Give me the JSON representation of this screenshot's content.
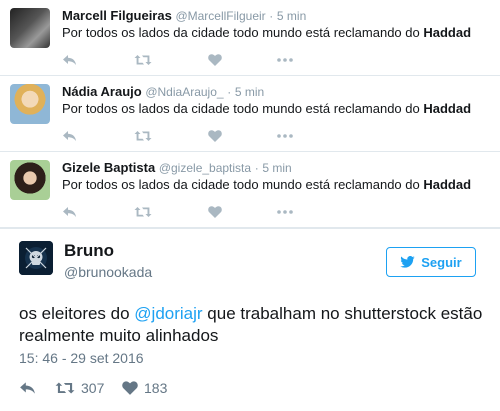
{
  "tweets": [
    {
      "name": "Marcell Filgueiras",
      "handle": "@MarcellFilgueir",
      "time": "5 min",
      "text_before": "Por todos os lados da cidade todo mundo está reclamando do ",
      "text_bold": "Haddad",
      "avatar_colors": [
        "#222222",
        "#777777"
      ]
    },
    {
      "name": "Nádia Araujo",
      "handle": "@NdiaAraujo_",
      "time": "5 min",
      "text_before": "Por todos os lados da cidade todo mundo está reclamando do ",
      "text_bold": "Haddad",
      "avatar_colors": [
        "#e8c07a",
        "#7aa5c8"
      ]
    },
    {
      "name": "Gizele Baptista",
      "handle": "@gizele_baptista",
      "time": "5 min",
      "text_before": "Por todos os lados da cidade todo mundo está reclamando do ",
      "text_bold": "Haddad",
      "avatar_colors": [
        "#3a2a22",
        "#9fc38d"
      ]
    }
  ],
  "separator": "·",
  "expanded": {
    "name": "Bruno",
    "handle": "@brunookada",
    "follow_label": "Seguir",
    "text_before": "os eleitores do ",
    "mention": "@jdoriajr",
    "text_after": " que trabalham no shutterstock estão realmente muito alinhados",
    "timestamp": "15: 46 - 29 set 2016",
    "retweets": "307",
    "likes": "183"
  },
  "colors": {
    "accent": "#1da1f2",
    "muted": "#8899a6",
    "icon": "#aab8c2",
    "border": "#e1e8ed"
  },
  "icons": [
    "reply-icon",
    "retweet-icon",
    "heart-icon",
    "more-icon",
    "twitter-bird-icon",
    "skull-avatar-icon"
  ]
}
